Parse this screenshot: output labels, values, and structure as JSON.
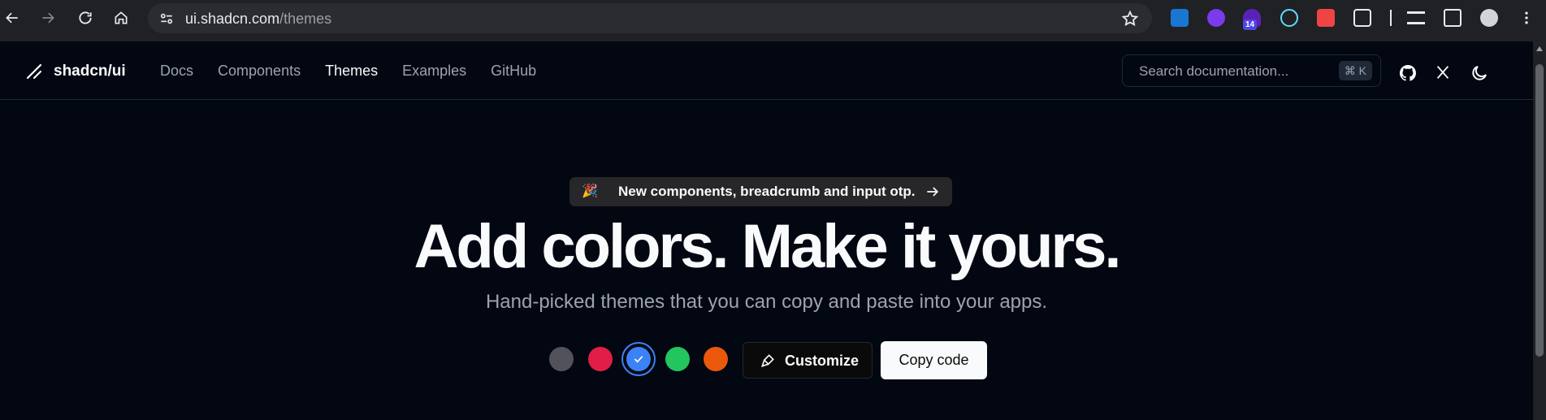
{
  "browser": {
    "url_host": "ui.shadcn.com",
    "url_path": "/themes",
    "extension_badge": "14"
  },
  "site": {
    "brand": "shadcn/ui",
    "nav": [
      {
        "label": "Docs",
        "active": false
      },
      {
        "label": "Components",
        "active": false
      },
      {
        "label": "Themes",
        "active": true
      },
      {
        "label": "Examples",
        "active": false
      },
      {
        "label": "GitHub",
        "active": false
      }
    ],
    "search_placeholder": "Search documentation...",
    "search_shortcut": "⌘ K"
  },
  "hero": {
    "announcement_emoji": "🎉",
    "announcement": "New components, breadcrumb and input otp.",
    "headline": "Add colors. Make it yours.",
    "subheadline": "Hand-picked themes that you can copy and paste into your apps.",
    "swatches": [
      {
        "name": "zinc",
        "color": "#52525b",
        "selected": false
      },
      {
        "name": "rose",
        "color": "#e11d48",
        "selected": false
      },
      {
        "name": "blue",
        "color": "#3b82f6",
        "selected": true
      },
      {
        "name": "green",
        "color": "#22c55e",
        "selected": false
      },
      {
        "name": "orange",
        "color": "#ea580c",
        "selected": false
      }
    ],
    "customize_label": "Customize",
    "copy_label": "Copy code"
  }
}
